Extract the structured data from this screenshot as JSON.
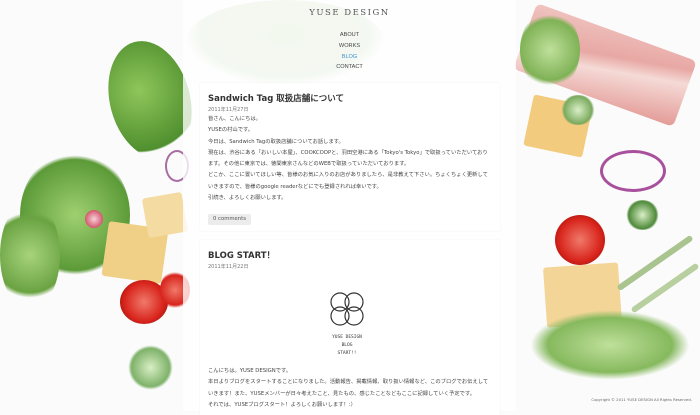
{
  "site": {
    "logo": "YUSE DESIGN"
  },
  "nav": {
    "items": [
      {
        "label": "ABOUT",
        "active": false
      },
      {
        "label": "WORKS",
        "active": false
      },
      {
        "label": "BLOG",
        "active": true
      },
      {
        "label": "CONTACT",
        "active": false
      }
    ]
  },
  "posts": [
    {
      "title": "Sandwich Tag 取扱店舗について",
      "date": "2011年11月27日",
      "paragraphs": [
        "皆さん、こんにちは。",
        "YUSEの村山です。",
        "今日は、Sandwich Tagの取扱店舗についてお話します。",
        "現在は、渋谷にある「おいしい本屋」、COOKCOOPと、羽田空港にある「Tokyo's Tokyo」で取扱っていただいており",
        "ます。その他に東京では、徳間東京さんなどのWEBで取扱っていただいております。",
        "どこか、ここに置いてほしい等、皆様のお気に入りのお店がありましたら、是非教えて下さい。ちょくちょく更新して",
        "いきますので、皆様のgoogle readerなどにでも登録されれば幸いです。",
        "引続き、よろしくお願いします。"
      ],
      "comments_label": "0 comments"
    },
    {
      "title": "BLOG START！",
      "date": "2011年11月22日",
      "image_caption": "YUSE DESIGN BLOG START!!",
      "paragraphs": [
        "こんにちは。YUSE DESIGNです。",
        "本日よりブログをスタートすることになりました。活動報告、掲載情報、取り扱い情報など、このブログでお伝えして",
        "いきます！また、YUSEメンバーが日々考えたこと、見たもの、感じたことなどもここに記録していく予定です。",
        "それでは、YUSEブログスタート！よろしくお願いします！:）"
      ]
    }
  ],
  "footer": {
    "copyright": "Copyright © 2011 YUSE DESIGN All Rights Reserved."
  },
  "colors": {
    "nav_active": "#3a8fd0",
    "background": "#fbfbfb"
  }
}
